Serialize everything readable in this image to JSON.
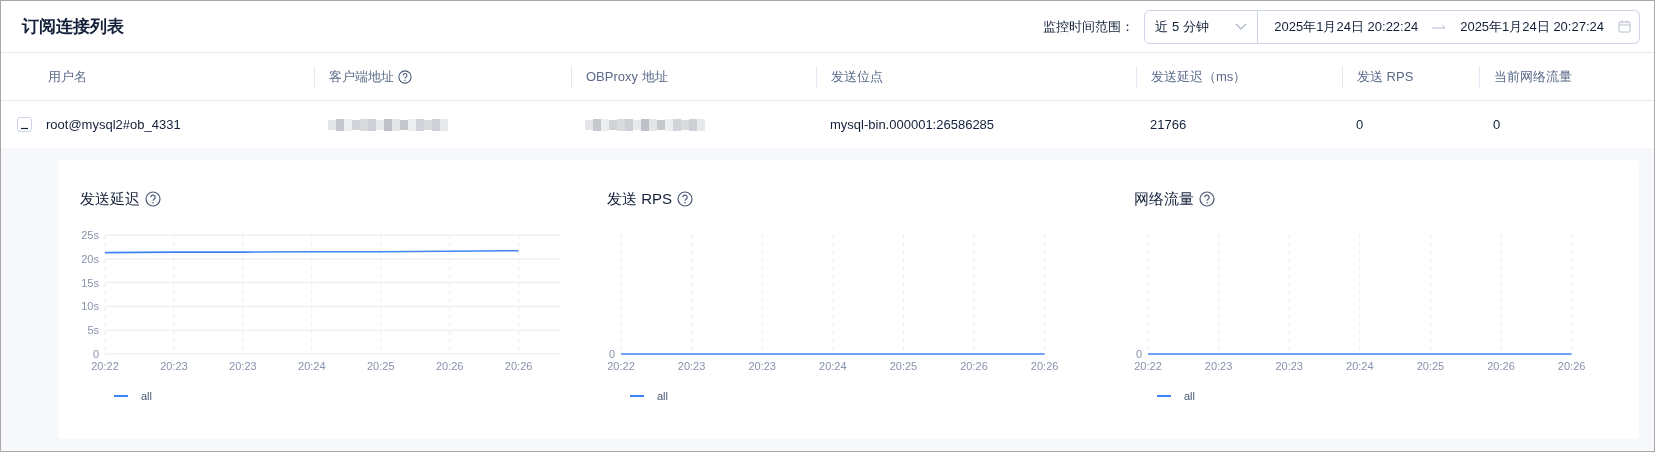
{
  "header": {
    "title": "订阅连接列表",
    "time_range": {
      "label": "监控时间范围：",
      "preset": "近 5 分钟",
      "start": "2025年1月24日 20:22:24",
      "end": "2025年1月24日 20:27:24"
    }
  },
  "table": {
    "columns": [
      {
        "label": "用户名",
        "help": false
      },
      {
        "label": "客户端地址",
        "help": true
      },
      {
        "label": "OBProxy 地址",
        "help": false
      },
      {
        "label": "发送位点",
        "help": false
      },
      {
        "label": "发送延迟（ms）",
        "help": false
      },
      {
        "label": "发送 RPS",
        "help": false
      },
      {
        "label": "当前网络流量",
        "help": false
      }
    ],
    "rows": [
      {
        "expanded": true,
        "cells": [
          {
            "kind": "text",
            "text": "root@mysql2#ob_4331"
          },
          {
            "kind": "blurred"
          },
          {
            "kind": "blurred"
          },
          {
            "kind": "text",
            "text": "mysql-bin.000001:26586285"
          },
          {
            "kind": "text",
            "text": "21766"
          },
          {
            "kind": "text",
            "text": "0"
          },
          {
            "kind": "text",
            "text": "0"
          }
        ],
        "charts": [
          {
            "title": "发送延迟",
            "help": true,
            "chart_data": {
              "type": "line",
              "grid": true,
              "categories": [
                "20:22",
                "20:23",
                "20:23",
                "20:24",
                "20:25",
                "20:26",
                "20:26"
              ],
              "ylim": [
                0,
                25
              ],
              "yticks": [
                {
                  "value": 0,
                  "label": "0"
                },
                {
                  "value": 5,
                  "label": "5s"
                },
                {
                  "value": 10,
                  "label": "10s"
                },
                {
                  "value": 15,
                  "label": "15s"
                },
                {
                  "value": 20,
                  "label": "20s"
                },
                {
                  "value": 25,
                  "label": "25s"
                }
              ],
              "series": [
                {
                  "name": "all",
                  "color": "#3f84f5",
                  "values": [
                    21.3,
                    21.4,
                    21.4,
                    21.5,
                    21.5,
                    21.6,
                    21.7
                  ]
                }
              ]
            }
          },
          {
            "title": "发送 RPS",
            "help": true,
            "baseline_label": "0",
            "x_labels": [
              "20:22",
              "20:23",
              "20:23",
              "20:24",
              "20:25",
              "20:26",
              "20:26"
            ],
            "legend": [
              "all"
            ]
          },
          {
            "title": "网络流量",
            "help": true,
            "baseline_label": "0",
            "x_labels": [
              "20:22",
              "20:23",
              "20:23",
              "20:24",
              "20:25",
              "20:26",
              "20:26"
            ],
            "legend": [
              "all"
            ]
          }
        ]
      }
    ]
  }
}
